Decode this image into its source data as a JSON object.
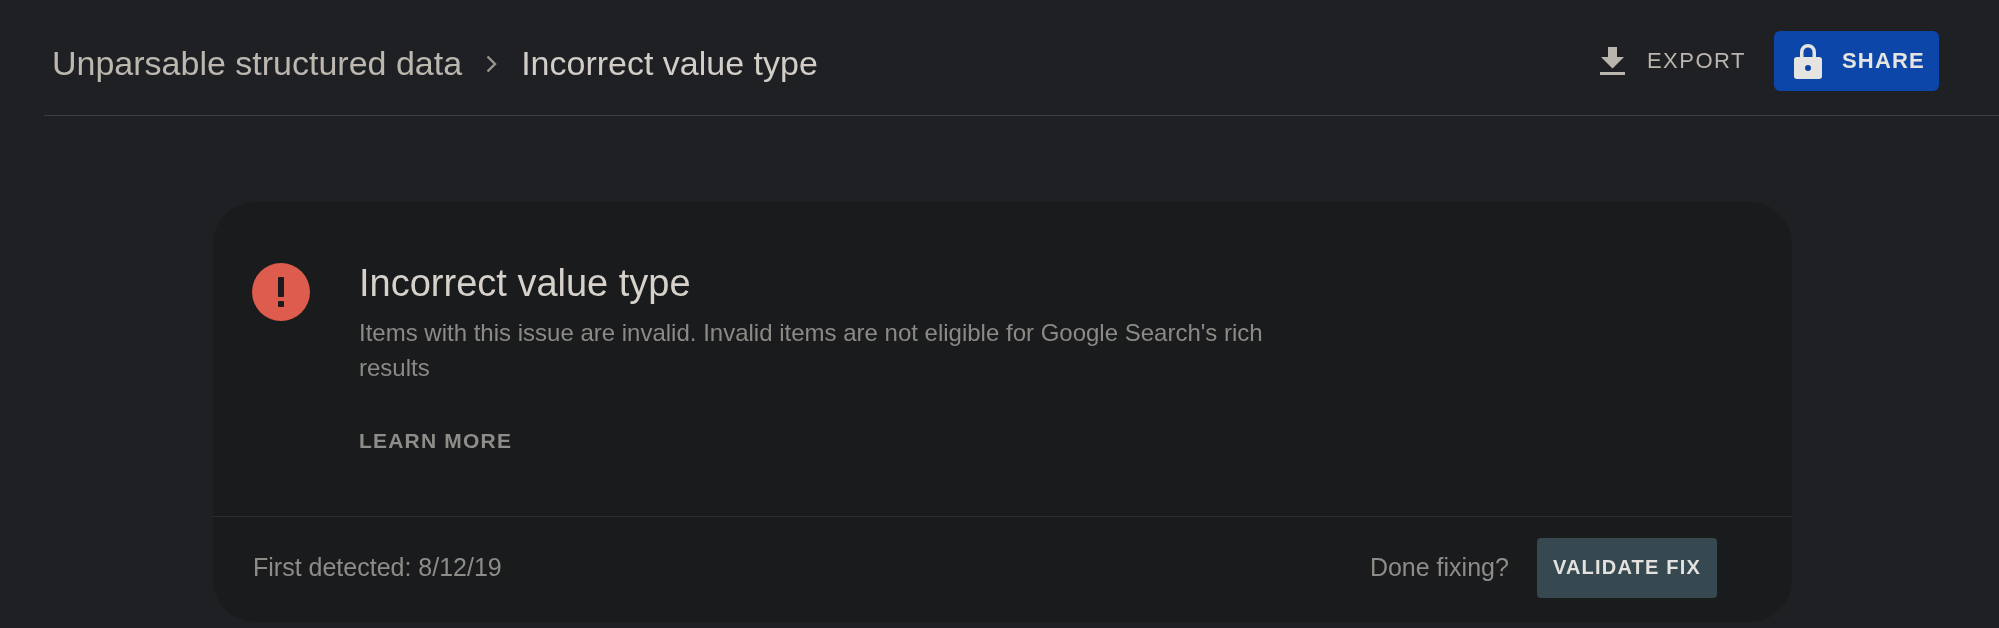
{
  "breadcrumb": [
    {
      "label": "Unparsable structured data",
      "current": false
    },
    {
      "label": "Incorrect value type",
      "current": true
    }
  ],
  "actions": [
    {
      "kind": "text",
      "label": "EXPORT"
    },
    {
      "kind": "filled",
      "label": "SHARE"
    }
  ],
  "issue_card": {
    "title": "Incorrect value type",
    "description": "Items with this issue are invalid. Invalid items are not eligible for Google Search's rich results",
    "link": "LEARN MORE",
    "first_detected": "First detected: 8/12/19",
    "prompt": "Done fixing?",
    "button": "VALIDATE FIX"
  }
}
